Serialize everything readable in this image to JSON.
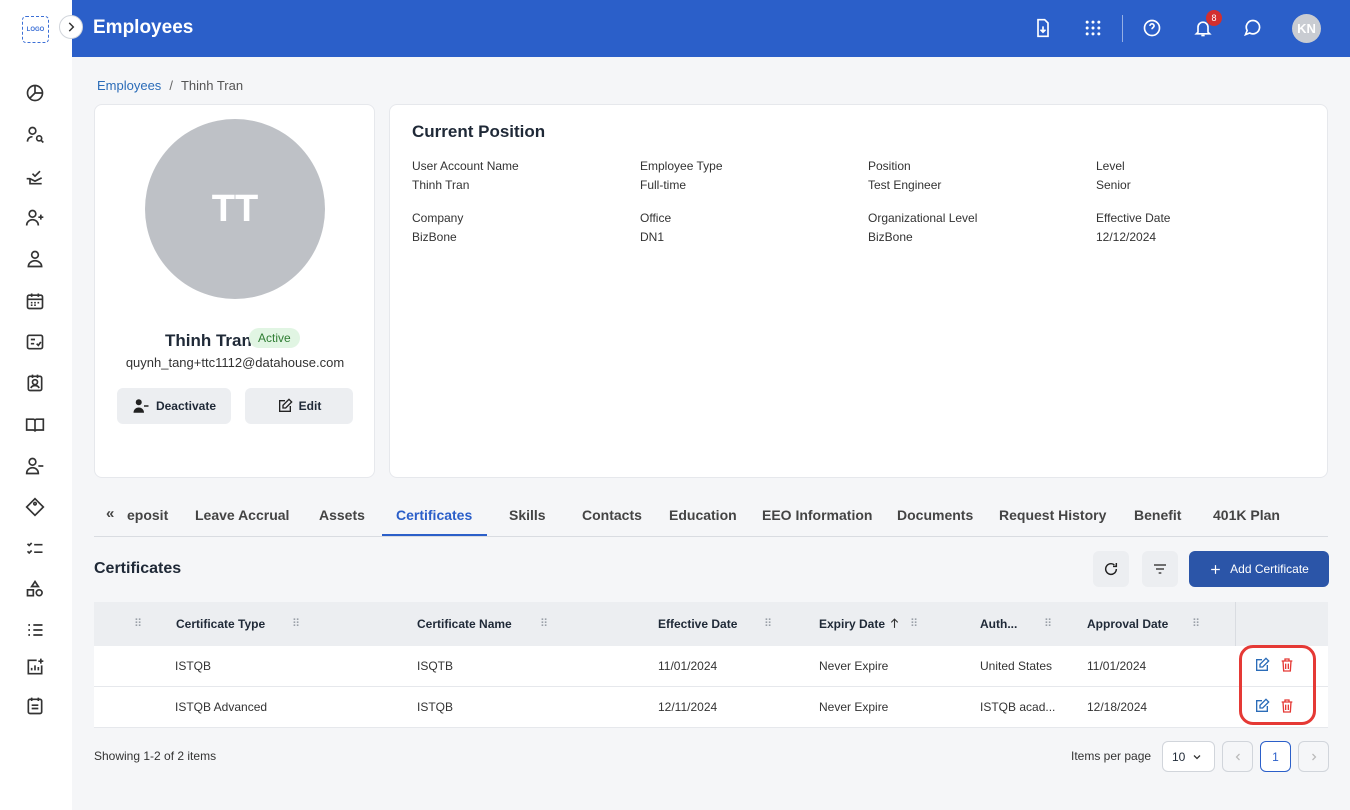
{
  "app": {
    "logo_text": "LOGO",
    "title": "Employees"
  },
  "topbar": {
    "notification_count": "8",
    "user_initials": "KN"
  },
  "breadcrumb": {
    "root": "Employees",
    "separator": "/",
    "current": "Thinh Tran"
  },
  "profile": {
    "initials": "TT",
    "name": "Thinh Tran",
    "status": "Active",
    "email": "quynh_tang+ttc1112@datahouse.com",
    "deactivate_label": "Deactivate",
    "edit_label": "Edit"
  },
  "position": {
    "title": "Current Position",
    "fields": [
      {
        "label": "User Account Name",
        "value": "Thinh Tran"
      },
      {
        "label": "Employee Type",
        "value": "Full-time"
      },
      {
        "label": "Position",
        "value": "Test Engineer"
      },
      {
        "label": "Level",
        "value": "Senior"
      },
      {
        "label": "Company",
        "value": "BizBone"
      },
      {
        "label": "Office",
        "value": "DN1"
      },
      {
        "label": "Organizational Level",
        "value": "BizBone"
      },
      {
        "label": "Effective Date",
        "value": "12/12/2024"
      }
    ]
  },
  "tabs": [
    "eposit",
    "Leave Accrual",
    "Assets",
    "Certificates",
    "Skills",
    "Contacts",
    "Education",
    "EEO Information",
    "Documents",
    "Request History",
    "Benefit",
    "401K Plan"
  ],
  "tabs_scroll_glyph": "«",
  "active_tab": "Certificates",
  "certificates": {
    "title": "Certificates",
    "add_label": "Add Certificate",
    "columns": [
      "Certificate Type",
      "Certificate Name",
      "Effective Date",
      "Expiry Date",
      "Auth...",
      "Approval Date"
    ],
    "rows": [
      [
        "ISTQB",
        "ISQTB",
        "11/01/2024",
        "Never Expire",
        "United States",
        "11/01/2024"
      ],
      [
        "ISTQB Advanced",
        "ISTQB",
        "12/11/2024",
        "Never Expire",
        "ISTQB acad...",
        "12/18/2024"
      ]
    ]
  },
  "pagination": {
    "summary": "Showing 1-2 of 2 items",
    "items_per_page_label": "Items per page",
    "items_per_page": "10",
    "current_page": "1"
  },
  "colors": {
    "brand": "#2b5fc9",
    "danger": "#e53935",
    "success_bg": "#e1f5e3"
  }
}
